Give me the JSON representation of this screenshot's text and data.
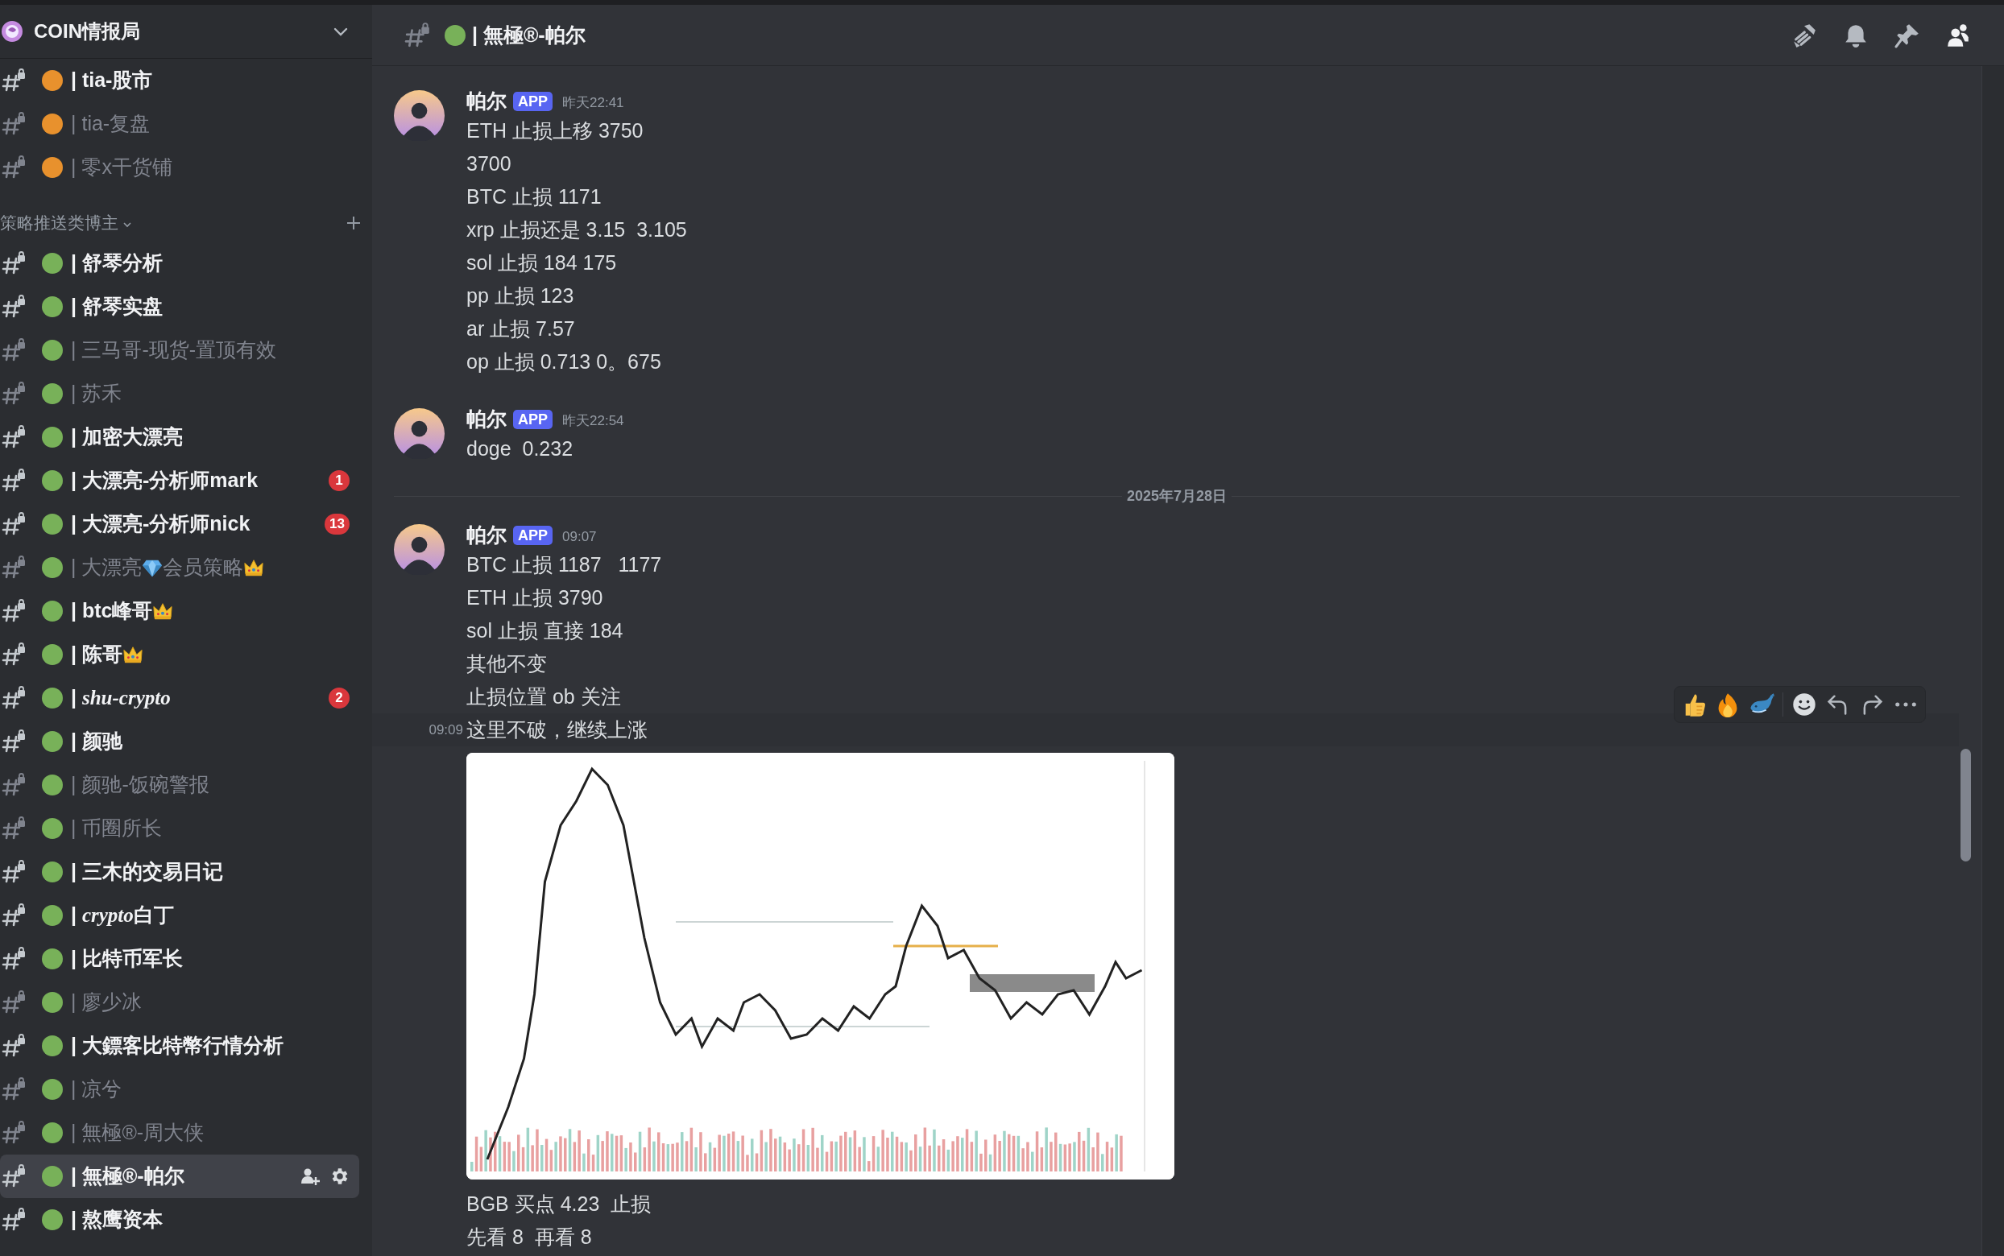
{
  "server": {
    "name": "COIN情报局"
  },
  "channels": [
    {
      "kind": "channel",
      "name": "| tia-股市",
      "unread": true,
      "color": "#e8912d",
      "selected": false
    },
    {
      "kind": "channel",
      "name": "| tia-复盘",
      "unread": false,
      "color": "#e8912d",
      "selected": false
    },
    {
      "kind": "channel",
      "name": "| 零x干货铺",
      "unread": false,
      "color": "#e8912d",
      "selected": false
    },
    {
      "kind": "category",
      "label": "策略推送类博主"
    },
    {
      "kind": "channel",
      "name": "| 舒琴分析",
      "unread": true,
      "color": "#78b159",
      "selected": false
    },
    {
      "kind": "channel",
      "name": "| 舒琴实盘",
      "unread": true,
      "color": "#78b159",
      "selected": false
    },
    {
      "kind": "channel",
      "name": "| 三马哥-现货-置顶有效",
      "unread": false,
      "color": "#78b159",
      "selected": false
    },
    {
      "kind": "channel",
      "name": "| 苏禾",
      "unread": false,
      "color": "#78b159",
      "selected": false
    },
    {
      "kind": "channel",
      "name": "| 加密大漂亮",
      "unread": true,
      "color": "#78b159",
      "selected": false
    },
    {
      "kind": "channel",
      "name": "| 大漂亮-分析师mark",
      "unread": true,
      "color": "#78b159",
      "selected": false,
      "badge": "1"
    },
    {
      "kind": "channel",
      "name": "| 大漂亮-分析师nick",
      "unread": true,
      "color": "#78b159",
      "selected": false,
      "badge": "13"
    },
    {
      "kind": "channel",
      "parts": [
        {
          "kind": "text",
          "text": "| 大漂亮"
        },
        {
          "kind": "gem"
        },
        {
          "kind": "text",
          "text": "会员策略"
        },
        {
          "kind": "crown"
        }
      ],
      "unread": false,
      "color": "#78b159",
      "selected": false
    },
    {
      "kind": "channel",
      "parts": [
        {
          "kind": "text",
          "text": "| btc峰哥"
        },
        {
          "kind": "crown"
        }
      ],
      "unread": true,
      "color": "#78b159",
      "selected": false
    },
    {
      "kind": "channel",
      "parts": [
        {
          "kind": "text",
          "text": "| 陈哥"
        },
        {
          "kind": "crown"
        }
      ],
      "unread": true,
      "color": "#78b159",
      "selected": false
    },
    {
      "kind": "channel",
      "parts": [
        {
          "kind": "text",
          "text": "| "
        },
        {
          "kind": "text",
          "text": "shu-crypto",
          "italic": true
        }
      ],
      "unread": true,
      "color": "#78b159",
      "selected": false,
      "badge": "2"
    },
    {
      "kind": "channel",
      "name": "| 颜驰",
      "unread": true,
      "color": "#78b159",
      "selected": false
    },
    {
      "kind": "channel",
      "name": "| 颜驰-饭碗警报",
      "unread": false,
      "color": "#78b159",
      "selected": false
    },
    {
      "kind": "channel",
      "name": "| 币圈所长",
      "unread": false,
      "color": "#78b159",
      "selected": false
    },
    {
      "kind": "channel",
      "name": "| 三木的交易日记",
      "unread": true,
      "color": "#78b159",
      "selected": false
    },
    {
      "kind": "channel",
      "parts": [
        {
          "kind": "text",
          "text": "| "
        },
        {
          "kind": "text",
          "text": "crypto",
          "italic": true
        },
        {
          "kind": "text",
          "text": "白丁"
        }
      ],
      "unread": true,
      "color": "#78b159",
      "selected": false
    },
    {
      "kind": "channel",
      "name": "| 比特币军长",
      "unread": true,
      "color": "#78b159",
      "selected": false
    },
    {
      "kind": "channel",
      "name": "| 廖少冰",
      "unread": false,
      "color": "#78b159",
      "selected": false
    },
    {
      "kind": "channel",
      "name": "| 大鏢客比特幣行情分析",
      "unread": true,
      "color": "#78b159",
      "selected": false
    },
    {
      "kind": "channel",
      "name": "| 凉兮",
      "unread": false,
      "color": "#78b159",
      "selected": false
    },
    {
      "kind": "channel",
      "name": "| 無極®-周大侠",
      "unread": false,
      "color": "#78b159",
      "selected": false
    },
    {
      "kind": "channel",
      "name": "| 無極®-帕尔",
      "unread": true,
      "color": "#78b159",
      "selected": true
    },
    {
      "kind": "channel",
      "name": "| 熬鹰资本",
      "unread": true,
      "color": "#78b159",
      "selected": false
    }
  ],
  "header": {
    "name": "| 無極®-帕尔",
    "color": "#78b159",
    "tools": [
      {
        "kind": "threads",
        "active": false
      },
      {
        "kind": "bell",
        "active": false
      },
      {
        "kind": "pin",
        "active": false
      },
      {
        "kind": "members",
        "active": true
      }
    ]
  },
  "feed": [
    {
      "kind": "message",
      "author": "帕尔",
      "tag": "APP",
      "time": "昨天22:41",
      "lines": [
        "ETH 止损上移 3750",
        "3700",
        "BTC 止损 1171",
        "xrp 止损还是 3.15  3.105",
        "sol 止损 184 175",
        "pp 止损 123",
        "ar 止损 7.57",
        "op 止损 0.713 0。675"
      ]
    },
    {
      "kind": "message",
      "author": "帕尔",
      "tag": "APP",
      "time": "昨天22:54",
      "lines": [
        "doge  0.232"
      ]
    },
    {
      "kind": "divider",
      "label": "2025年7月28日"
    },
    {
      "kind": "message",
      "author": "帕尔",
      "tag": "APP",
      "time": "09:07",
      "lines": [
        "BTC 止损 1187   1177",
        "ETH 止损 3790",
        "sol 止损 直接 184",
        "其他不变",
        "止损位置 ob 关注"
      ]
    },
    {
      "kind": "followup",
      "hovered": true,
      "time": "09:09",
      "lines": [
        "这里不破，继续上涨"
      ]
    },
    {
      "kind": "image"
    },
    {
      "kind": "followup",
      "lines": [
        "BGB 买点 4.23  止损",
        "先看 8  再看 8"
      ]
    }
  ],
  "hover_toolbar": {
    "reactions": [
      {
        "kind": "thumbs-up"
      },
      {
        "kind": "fire"
      },
      {
        "kind": "whale"
      }
    ],
    "actions": [
      {
        "kind": "emoji"
      },
      {
        "kind": "reply"
      },
      {
        "kind": "forward"
      },
      {
        "kind": "more"
      }
    ]
  }
}
